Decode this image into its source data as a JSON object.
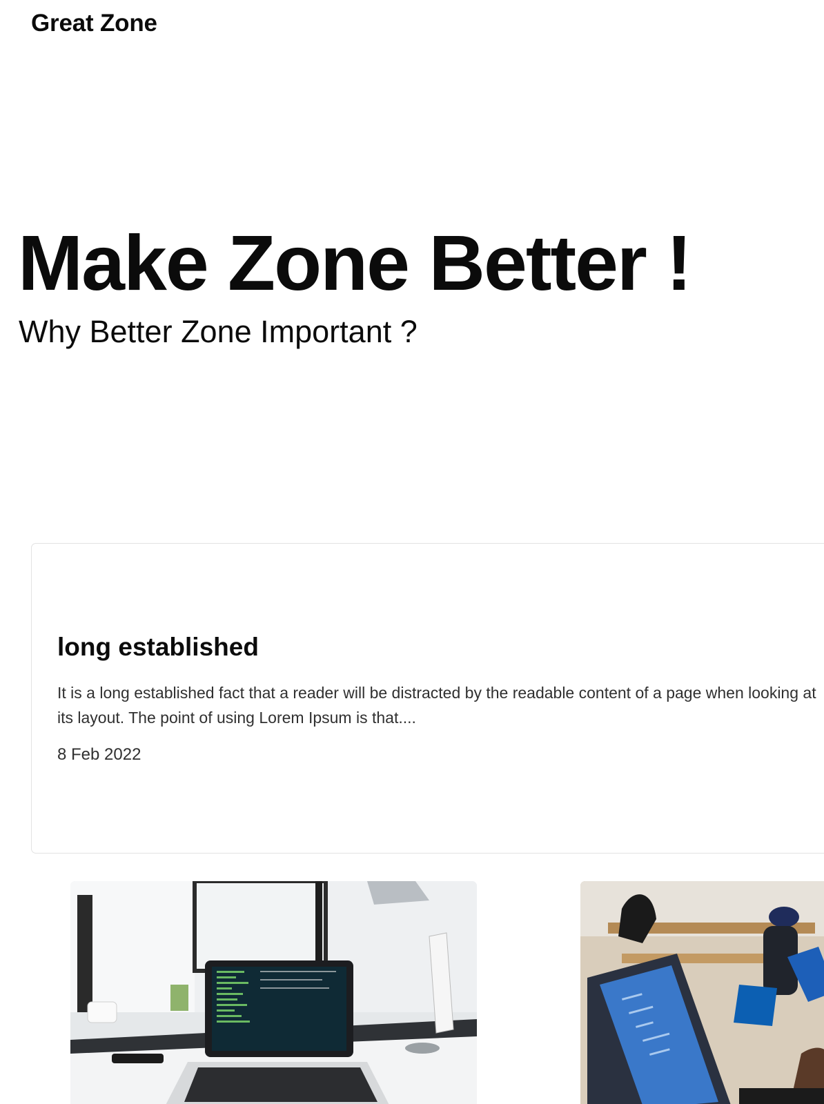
{
  "header": {
    "brand": "Great Zone"
  },
  "hero": {
    "title": "Make Zone Better !",
    "subtitle": "Why Better Zone Important ?"
  },
  "featured_post": {
    "title": "long established",
    "excerpt_line1": "It is a long established fact that a reader will be distracted by the readable content of a page when looking at",
    "excerpt_line2": "its layout. The point of using Lorem Ipsum is that....",
    "date": "8 Feb 2022"
  },
  "gallery": {
    "images": [
      {
        "name": "laptop-on-desk-image"
      },
      {
        "name": "people-coding-image"
      }
    ]
  },
  "colors": {
    "text": "#0b0b0b",
    "muted_text": "#303030",
    "card_border": "#e2e2e2"
  }
}
